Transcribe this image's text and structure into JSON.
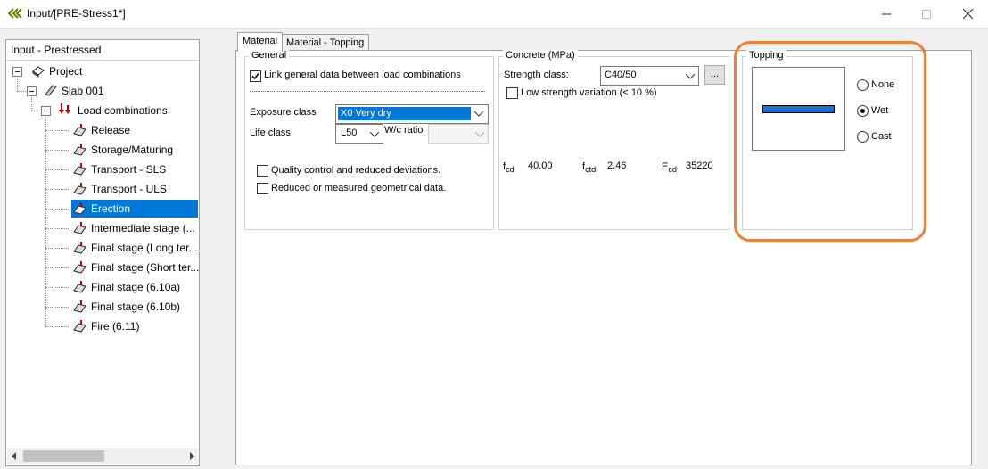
{
  "window": {
    "title": "Input/[PRE-Stress1*]"
  },
  "tree": {
    "header": "Input - Prestressed",
    "project": "Project",
    "slab": "Slab 001",
    "load_combinations": "Load combinations",
    "items": [
      "Release",
      "Storage/Maturing",
      "Transport - SLS",
      "Transport - ULS",
      "Erection",
      "Intermediate stage (...",
      "Final stage (Long ter...",
      "Final stage (Short ter...",
      "Final stage (6.10a)",
      "Final stage (6.10b)",
      "Fire (6.11)"
    ],
    "selected_index": 4
  },
  "tabs": [
    "Material",
    "Material - Topping"
  ],
  "general": {
    "title": "General",
    "link_label": "Link general data between load combinations",
    "link_checked": true,
    "exposure_label": "Exposure class",
    "exposure_value": "X0 Very dry",
    "life_label": "Life class",
    "life_value": "L50",
    "wc_label": "W/c ratio",
    "wc_value": "",
    "quality_label": "Quality control and reduced deviations.",
    "geometry_label": "Reduced or measured geometrical data."
  },
  "concrete": {
    "title": "Concrete (MPa)",
    "strength_label": "Strength class:",
    "strength_value": "C40/50",
    "browse_label": "...",
    "low_strength_label": "Low strength variation (< 10 %)",
    "fcd_base": "f",
    "fcd_sub": "cd",
    "fcd_value": "40.00",
    "fctd_base": "f",
    "fctd_sub": "ctd",
    "fctd_value": "2.46",
    "ecd_base": "E",
    "ecd_sub": "cd",
    "ecd_value": "35220"
  },
  "topping": {
    "title": "Topping",
    "options": [
      "None",
      "Wet",
      "Cast"
    ],
    "selected": "Wet",
    "highlight_color": "#f08030",
    "slab_color": "#1e6fd9"
  }
}
